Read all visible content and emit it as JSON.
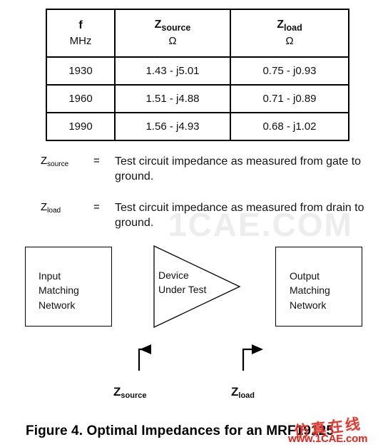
{
  "table": {
    "columns": [
      {
        "symbol": "f",
        "sub": "",
        "unit": "MHz"
      },
      {
        "symbol": "Z",
        "sub": "source",
        "unit": "Ω"
      },
      {
        "symbol": "Z",
        "sub": "load",
        "unit": "Ω"
      }
    ],
    "rows": [
      {
        "f": "1930",
        "z_source": "1.43  - j5.01",
        "z_load": "0.75  - j0.93"
      },
      {
        "f": "1960",
        "z_source": "1.51  - j4.88",
        "z_load": "0.71  - j0.89"
      },
      {
        "f": "1990",
        "z_source": "1.56  - j4.93",
        "z_load": "0.68  - j1.02"
      }
    ]
  },
  "definitions": [
    {
      "symbol": "Z",
      "subscript": "source",
      "equals": "=",
      "text": "Test circuit impedance as measured from gate to ground."
    },
    {
      "symbol": "Z",
      "subscript": "load",
      "equals": "=",
      "text": "Test circuit impedance as measured from drain to ground."
    }
  ],
  "diagram": {
    "input_block": "Input\nMatching\nNetwork",
    "device_under_test": "Device\nUnder Test",
    "output_block": "Output\nMatching\nNetwork",
    "annotations": [
      {
        "symbol": "Z",
        "subscript": "source",
        "direction": "left"
      },
      {
        "symbol": "Z",
        "subscript": "load",
        "direction": "right"
      }
    ]
  },
  "caption": "Figure 4.  Optimal Impedances for an MRF19125",
  "watermark": {
    "background_text": "1CAE.COM",
    "chinese": "仿真在线",
    "url": "www.1CAE.com",
    "color": "#e2231a"
  }
}
